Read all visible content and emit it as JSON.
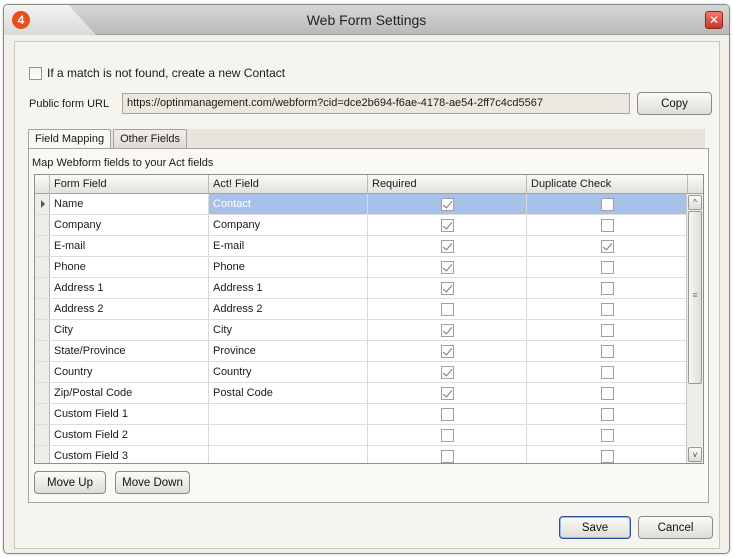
{
  "window": {
    "title": "Web Form Settings",
    "app_icon_label": "4",
    "close_glyph": "✕"
  },
  "match": {
    "label": "If a match is not found, create a new Contact",
    "checked": false
  },
  "url": {
    "label": "Public form URL",
    "value": "https://optinmanagement.com/webform?cid=dce2b694-f6ae-4178-ae54-2ff7c4cd5567",
    "copy_label": "Copy"
  },
  "tabs": [
    {
      "label": "Field Mapping",
      "active": true
    },
    {
      "label": "Other Fields",
      "active": false
    }
  ],
  "panel": {
    "caption": "Map Webform fields to your Act fields"
  },
  "grid": {
    "columns": [
      "Form Field",
      "Act! Field",
      "Required",
      "Duplicate Check"
    ],
    "rows": [
      {
        "form": "Name",
        "act": "Contact",
        "required": true,
        "dup": false,
        "selected": true
      },
      {
        "form": "Company",
        "act": "Company",
        "required": true,
        "dup": false
      },
      {
        "form": "E-mail",
        "act": "E-mail",
        "required": true,
        "dup": true
      },
      {
        "form": "Phone",
        "act": "Phone",
        "required": true,
        "dup": false
      },
      {
        "form": "Address 1",
        "act": "Address 1",
        "required": true,
        "dup": false
      },
      {
        "form": "Address 2",
        "act": "Address 2",
        "required": false,
        "dup": false
      },
      {
        "form": "City",
        "act": "City",
        "required": true,
        "dup": false
      },
      {
        "form": "State/Province",
        "act": "Province",
        "required": true,
        "dup": false
      },
      {
        "form": "Country",
        "act": "Country",
        "required": true,
        "dup": false
      },
      {
        "form": "Zip/Postal Code",
        "act": "Postal Code",
        "required": true,
        "dup": false
      },
      {
        "form": "Custom Field 1",
        "act": "",
        "required": false,
        "dup": false
      },
      {
        "form": "Custom Field 2",
        "act": "",
        "required": false,
        "dup": false
      },
      {
        "form": "Custom Field 3",
        "act": "",
        "required": false,
        "dup": false
      }
    ]
  },
  "buttons": {
    "move_up": "Move Up",
    "move_down": "Move Down",
    "save": "Save",
    "cancel": "Cancel"
  },
  "icons": {
    "scroll_up": "^",
    "scroll_down": "v",
    "scroll_grip": "≡"
  }
}
